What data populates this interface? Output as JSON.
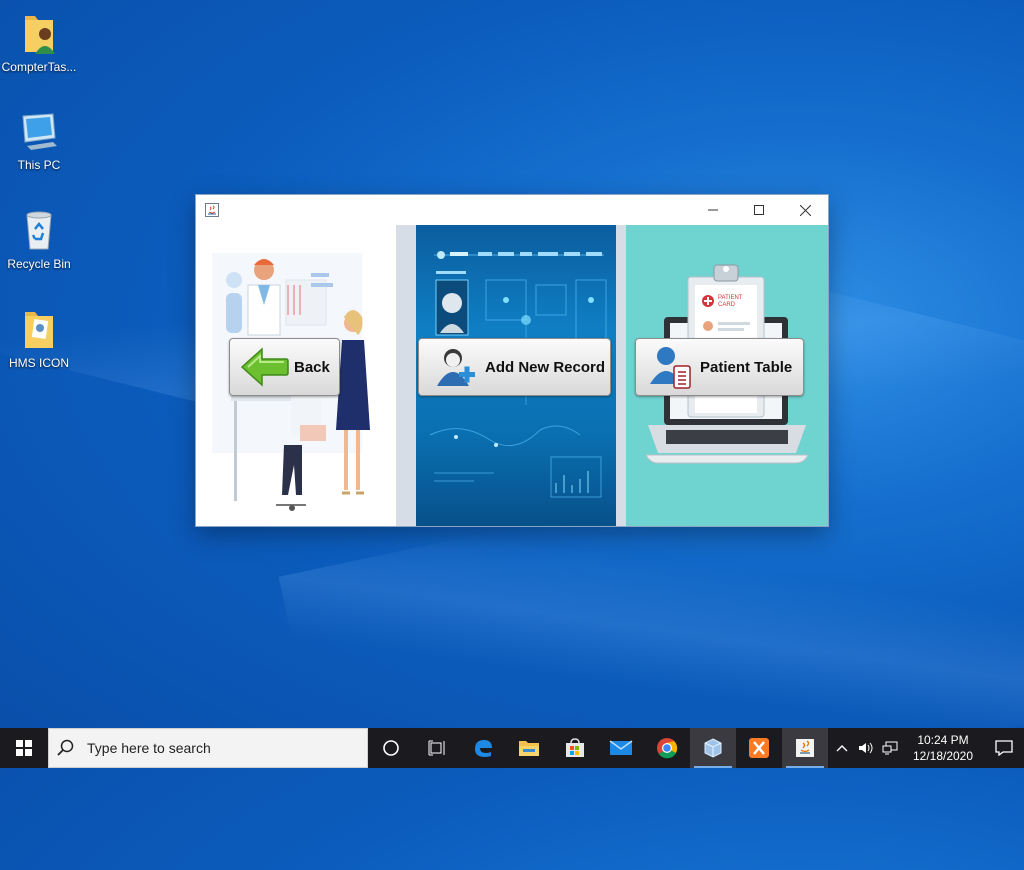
{
  "desktop": {
    "icons": [
      {
        "label": "CompterTas..."
      },
      {
        "label": "This PC"
      },
      {
        "label": "Recycle Bin"
      },
      {
        "label": "HMS ICON"
      }
    ]
  },
  "window": {
    "buttons": {
      "back": "Back",
      "add_record": "Add New Record",
      "patient_table": "Patient Table"
    },
    "patient_card": {
      "line1": "PATIENT",
      "line2": "CARD"
    }
  },
  "taskbar": {
    "search_placeholder": "Type here to search",
    "clock_time": "10:24 PM",
    "clock_date": "12/18/2020",
    "apps": [
      "task-view-icon",
      "edge-icon",
      "file-explorer-icon",
      "store-icon",
      "mail-icon",
      "chrome-icon",
      "virtualbox-icon",
      "xampp-icon",
      "java-icon"
    ]
  },
  "colors": {
    "desktop_blue": "#0b5cbd",
    "taskbar": "#1b1b1f",
    "panel_teal": "#6fd3d0",
    "panel_blue": "#0f7fc4"
  }
}
